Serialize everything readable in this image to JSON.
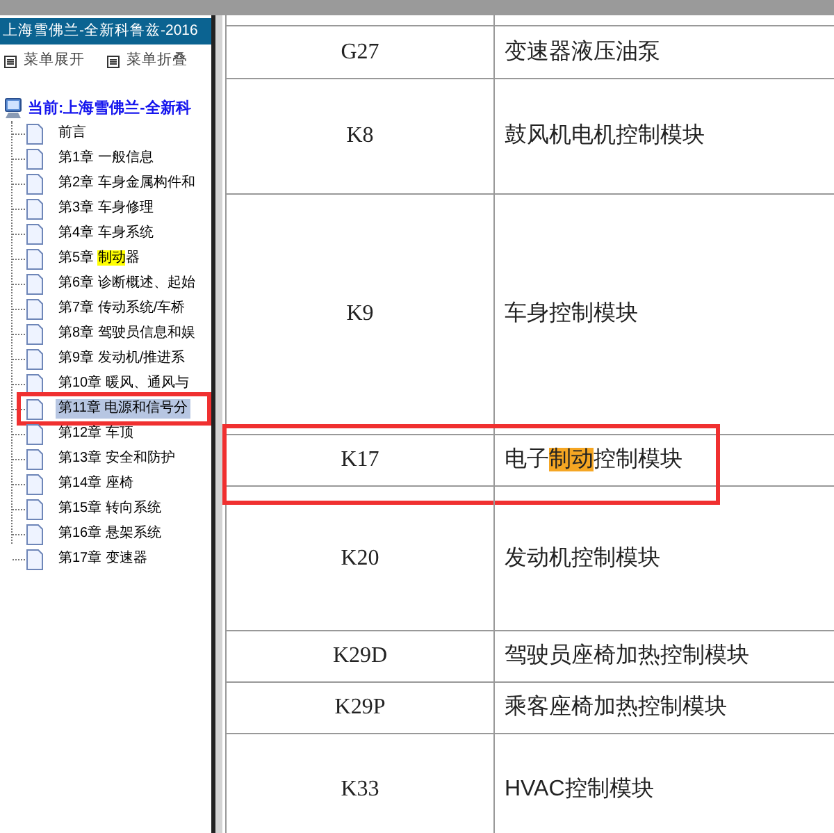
{
  "sidebar": {
    "title": "上海雪佛兰-全新科鲁兹-2016",
    "menu_buttons": [
      "菜单展开",
      "菜单折叠"
    ],
    "root": "当前:上海雪佛兰-全新科",
    "items": [
      {
        "label": "前言",
        "selected": false,
        "boxed": false
      },
      {
        "label": "第1章 一般信息",
        "selected": false,
        "boxed": false
      },
      {
        "label": "第2章 车身金属构件和",
        "selected": false,
        "boxed": false
      },
      {
        "label": "第3章 车身修理",
        "selected": false,
        "boxed": false
      },
      {
        "label": "第4章 车身系统",
        "selected": false,
        "boxed": false
      },
      {
        "label": "第5章 ",
        "highlight": "制动",
        "after": "器",
        "selected": false,
        "boxed": false
      },
      {
        "label": "第6章 诊断概述、起始",
        "selected": false,
        "boxed": false
      },
      {
        "label": "第7章 传动系统/车桥",
        "selected": false,
        "boxed": false
      },
      {
        "label": "第8章 驾驶员信息和娱",
        "selected": false,
        "boxed": false
      },
      {
        "label": "第9章 发动机/推进系",
        "selected": false,
        "boxed": false
      },
      {
        "label": "第10章 暖风、通风与",
        "selected": false,
        "boxed": false
      },
      {
        "label": "第11章 电源和信号分",
        "selected": true,
        "boxed": true
      },
      {
        "label": "第12章 车顶",
        "selected": false,
        "boxed": false
      },
      {
        "label": "第13章 安全和防护",
        "selected": false,
        "boxed": false
      },
      {
        "label": "第14章 座椅",
        "selected": false,
        "boxed": false
      },
      {
        "label": "第15章 转向系统",
        "selected": false,
        "boxed": false
      },
      {
        "label": "第16章 悬架系统",
        "selected": false,
        "boxed": false
      },
      {
        "label": "第17章 变速器",
        "selected": false,
        "boxed": false
      }
    ]
  },
  "table": {
    "rows": [
      {
        "code": "G27",
        "name": "变速器液压油泵",
        "boxed": false
      },
      {
        "code": "K8",
        "name": "鼓风机电机控制模块",
        "boxed": false
      },
      {
        "code": "K9",
        "name": "车身控制模块",
        "boxed": false
      },
      {
        "code": "K17",
        "name": "电子",
        "highlight": "制动",
        "after": "控制模块",
        "boxed": true
      },
      {
        "code": "K20",
        "name": "发动机控制模块",
        "boxed": false
      },
      {
        "code": "K29D",
        "name": "驾驶员座椅加热控制模块",
        "boxed": false
      },
      {
        "code": "K29P",
        "name": "乘客座椅加热控制模块",
        "boxed": false
      },
      {
        "code": "K33",
        "name": "HVAC控制模块",
        "boxed": false
      }
    ]
  }
}
